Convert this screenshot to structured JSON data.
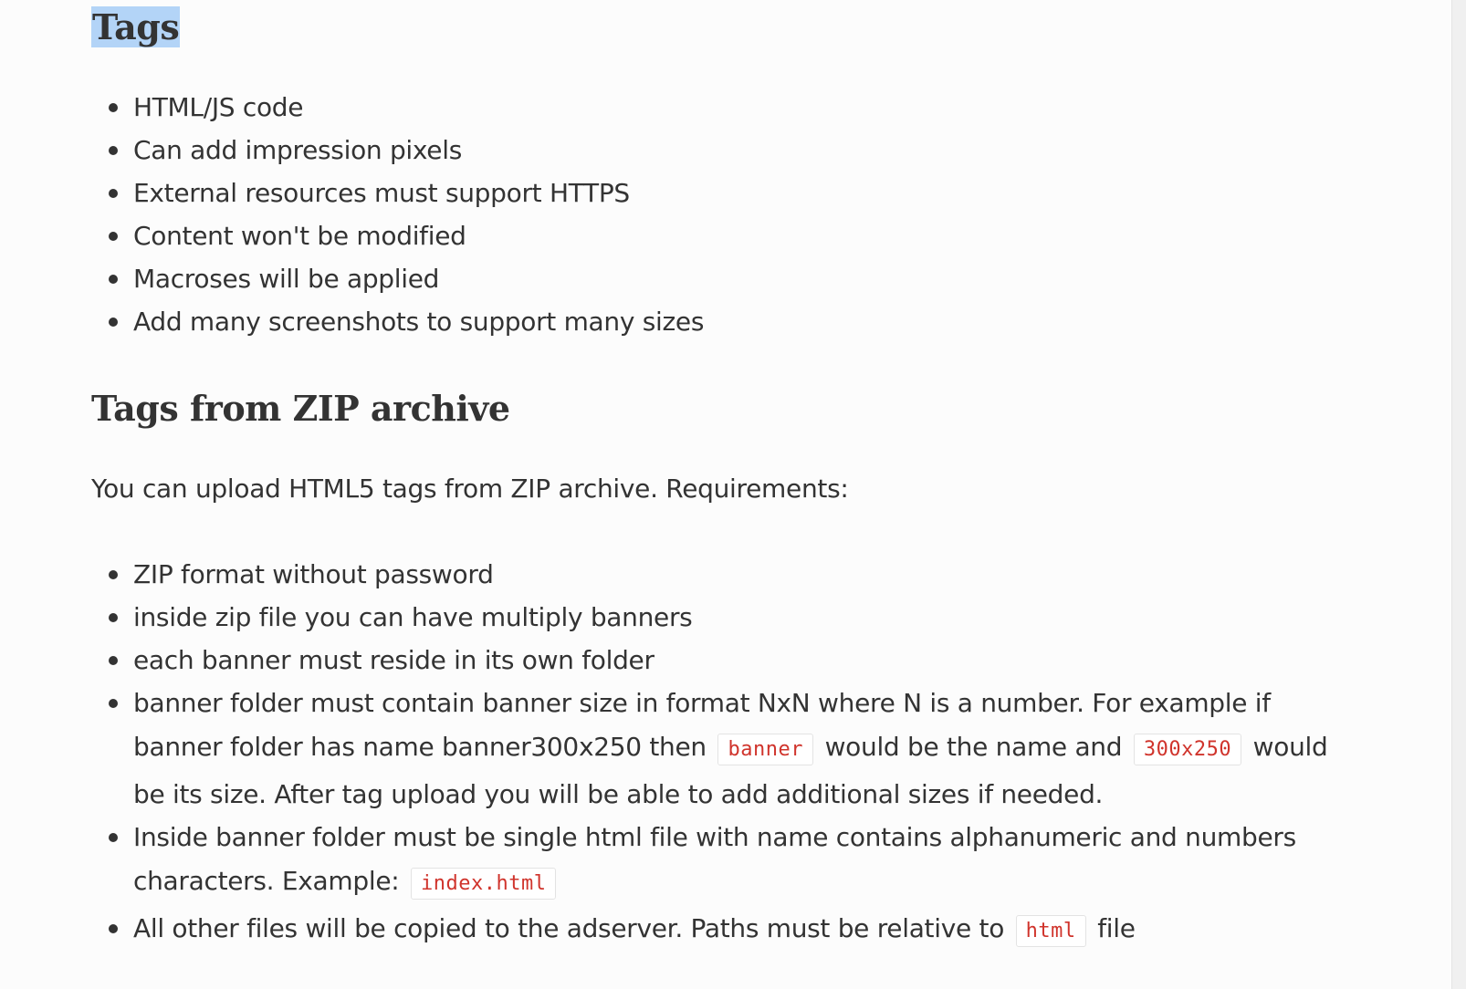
{
  "section_tags": {
    "heading": "Tags",
    "items": [
      "HTML/JS code",
      "Can add impression pixels",
      "External resources must support HTTPS",
      "Content won't be modified",
      "Macroses will be applied",
      "Add many screenshots to support many sizes"
    ]
  },
  "section_zip": {
    "heading": "Tags from ZIP archive",
    "intro": "You can upload HTML5 tags from ZIP archive. Requirements:",
    "items": {
      "zip_format": "ZIP format without password",
      "multiply_banners": "inside zip file you can have multiply banners",
      "own_folder": "each banner must reside in its own folder",
      "folder_size": {
        "line1": "banner folder must contain banner size in format NxN where N is a number. For example if",
        "line2_before": "banner folder has name banner300x250 then",
        "code_name": "banner",
        "line2_middle": "would be the name and",
        "code_size": "300x250",
        "line2_after": "would",
        "line3": "be its size. After tag upload you will be able to add additional sizes if needed."
      },
      "single_html": {
        "line1": "Inside banner folder must be single html file with name contains alphanumeric and numbers",
        "line2_before": "characters. Example:",
        "code_example": "index.html"
      },
      "copied_files": {
        "before": "All other files will be copied to the adserver. Paths must be relative to",
        "code": "html",
        "after": "file"
      }
    }
  },
  "colors": {
    "text": "#333333",
    "background": "#fcfcfc",
    "heading_highlight": "#b3d4f7",
    "code_text": "#d0342c",
    "code_border": "#e3e3e3"
  }
}
